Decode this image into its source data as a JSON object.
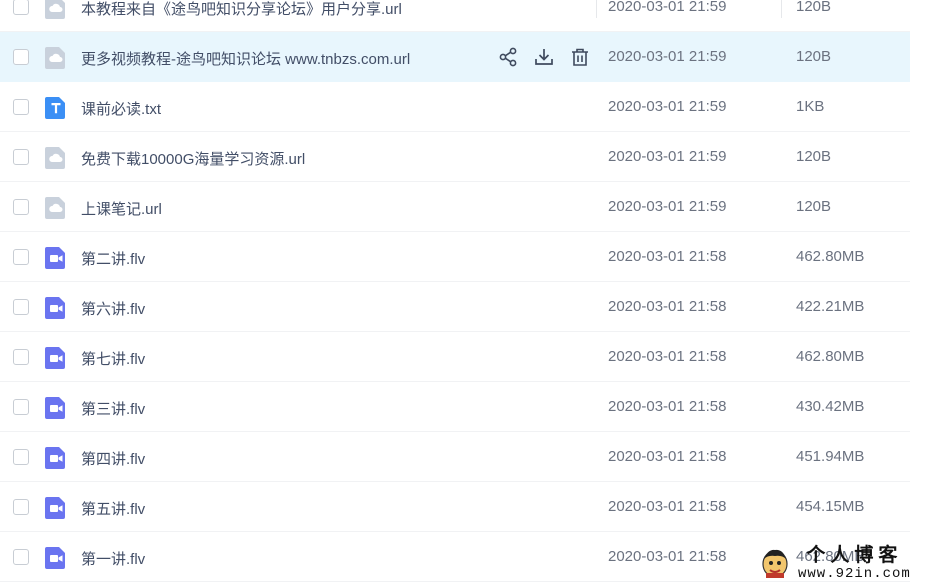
{
  "files": [
    {
      "name": "本教程来自《途鸟吧知识分享论坛》用户分享.url",
      "date": "2020-03-01 21:59",
      "size": "120B",
      "icon": "cloud-link-icon",
      "type": "link"
    },
    {
      "name": "更多视频教程-途鸟吧知识论坛 www.tnbzs.com.url",
      "date": "2020-03-01 21:59",
      "size": "120B",
      "icon": "cloud-link-icon",
      "type": "link",
      "hovered": true
    },
    {
      "name": "课前必读.txt",
      "date": "2020-03-01 21:59",
      "size": "1KB",
      "icon": "text-file-icon",
      "type": "txt"
    },
    {
      "name": "免费下载10000G海量学习资源.url",
      "date": "2020-03-01 21:59",
      "size": "120B",
      "icon": "cloud-link-icon",
      "type": "link"
    },
    {
      "name": "上课笔记.url",
      "date": "2020-03-01 21:59",
      "size": "120B",
      "icon": "cloud-link-icon",
      "type": "link"
    },
    {
      "name": "第二讲.flv",
      "date": "2020-03-01 21:58",
      "size": "462.80MB",
      "icon": "video-file-icon",
      "type": "video"
    },
    {
      "name": "第六讲.flv",
      "date": "2020-03-01 21:58",
      "size": "422.21MB",
      "icon": "video-file-icon",
      "type": "video"
    },
    {
      "name": "第七讲.flv",
      "date": "2020-03-01 21:58",
      "size": "462.80MB",
      "icon": "video-file-icon",
      "type": "video"
    },
    {
      "name": "第三讲.flv",
      "date": "2020-03-01 21:58",
      "size": "430.42MB",
      "icon": "video-file-icon",
      "type": "video"
    },
    {
      "name": "第四讲.flv",
      "date": "2020-03-01 21:58",
      "size": "451.94MB",
      "icon": "video-file-icon",
      "type": "video"
    },
    {
      "name": "第五讲.flv",
      "date": "2020-03-01 21:58",
      "size": "454.15MB",
      "icon": "video-file-icon",
      "type": "video"
    },
    {
      "name": "第一讲.flv",
      "date": "2020-03-01 21:58",
      "size": "462.80MB",
      "icon": "video-file-icon",
      "type": "video"
    }
  ],
  "row_actions": [
    {
      "name": "share-icon"
    },
    {
      "name": "download-icon"
    },
    {
      "name": "delete-icon"
    }
  ],
  "watermark": {
    "title": "个人博客",
    "url": "www.92in.com"
  },
  "colors": {
    "hover_row": "#e8f6fd",
    "video_icon": "#6a74f0",
    "text_icon": "#3b8ff5",
    "link_icon": "#c9d1dc",
    "text": "#424e67",
    "meta_text": "#6b7280"
  }
}
